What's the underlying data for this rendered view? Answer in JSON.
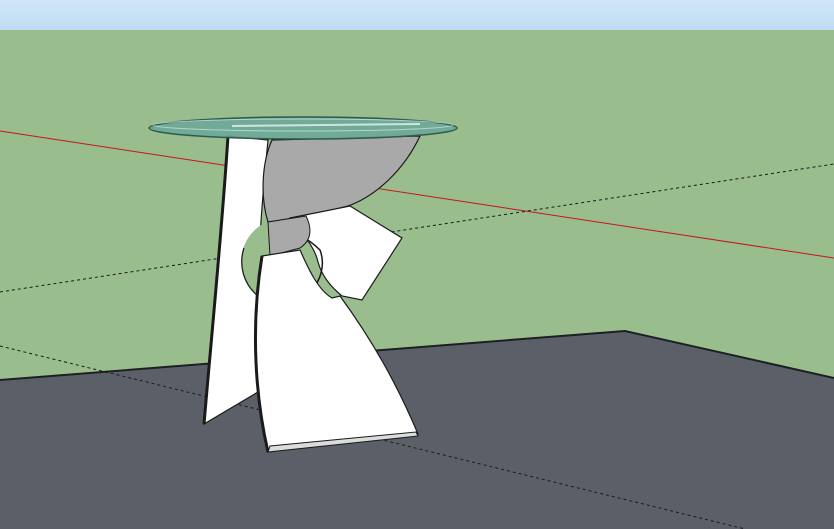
{
  "viewport": {
    "sky_color": "#cfe6f8",
    "sky_color_bottom": "#bfdcf3",
    "ground_color": "#9abd8e",
    "floor_color": "#5b6068",
    "floor_edge_color": "#1e1f22",
    "red_axis_color": "#c4161c",
    "dashed_axis_color": "#1a1a1a"
  },
  "model": {
    "name": "sculptural-glass-side-table",
    "glass_color": "#6aa89a",
    "glass_edge_color": "#2f5a50",
    "panel_color": "#ffffff",
    "panel_shadow_color": "#a9a9a9",
    "outline_color": "#1a1a1a"
  }
}
